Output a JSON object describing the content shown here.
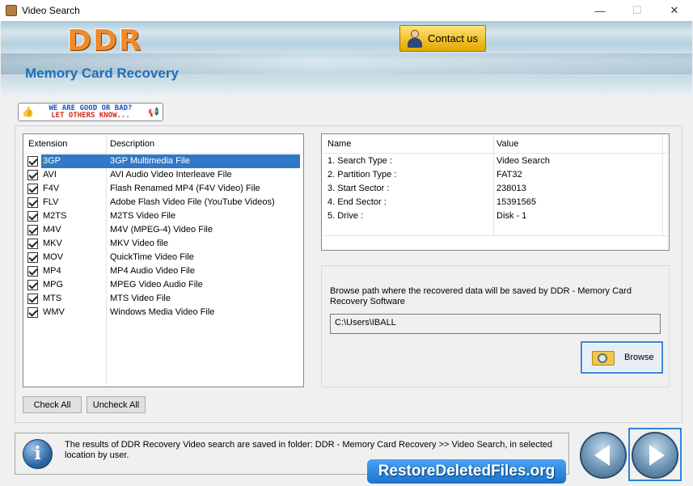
{
  "window": {
    "title": "Video Search",
    "minimize": "—",
    "maximize": "☐",
    "close": "✕"
  },
  "banner": {
    "logo": "DDR",
    "subtitle": "Memory Card Recovery",
    "contact_label": "Contact us"
  },
  "rating": {
    "line1": "WE ARE GOOD OR BAD?",
    "line2": "LET OTHERS KNOW..."
  },
  "extensions": {
    "header_extension": "Extension",
    "header_description": "Description",
    "rows": [
      {
        "ext": "3GP",
        "desc": "3GP Multimedia File",
        "checked": true,
        "selected": true
      },
      {
        "ext": "AVI",
        "desc": "AVI Audio Video Interleave File",
        "checked": true
      },
      {
        "ext": "F4V",
        "desc": "Flash Renamed MP4 (F4V Video) File",
        "checked": true
      },
      {
        "ext": "FLV",
        "desc": "Adobe Flash Video File (YouTube Videos)",
        "checked": true
      },
      {
        "ext": "M2TS",
        "desc": "M2TS Video File",
        "checked": true
      },
      {
        "ext": "M4V",
        "desc": "M4V (MPEG-4) Video File",
        "checked": true
      },
      {
        "ext": "MKV",
        "desc": "MKV Video file",
        "checked": true
      },
      {
        "ext": "MOV",
        "desc": "QuickTime Video File",
        "checked": true
      },
      {
        "ext": "MP4",
        "desc": "MP4 Audio Video File",
        "checked": true
      },
      {
        "ext": "MPG",
        "desc": "MPEG Video Audio File",
        "checked": true
      },
      {
        "ext": "MTS",
        "desc": "MTS Video File",
        "checked": true
      },
      {
        "ext": "WMV",
        "desc": "Windows Media Video File",
        "checked": true
      }
    ]
  },
  "info": {
    "header_name": "Name",
    "header_value": "Value",
    "rows": [
      {
        "name": "1. Search Type :",
        "value": "Video Search"
      },
      {
        "name": "2. Partition Type :",
        "value": "FAT32"
      },
      {
        "name": "3. Start Sector :",
        "value": "238013"
      },
      {
        "name": "4. End Sector :",
        "value": "15391565"
      },
      {
        "name": "5. Drive :",
        "value": "Disk - 1"
      }
    ]
  },
  "browse": {
    "text": "Browse path where the recovered data will be saved by DDR - Memory Card Recovery Software",
    "path": "C:\\Users\\IBALL",
    "button_label": "Browse"
  },
  "buttons": {
    "check_all": "Check All",
    "uncheck_all": "Uncheck All"
  },
  "status": {
    "text": "The results of DDR Recovery Video search are saved in folder: DDR - Memory Card Recovery  >> Video Search, in selected location by user."
  },
  "site_badge": "RestoreDeletedFiles.org",
  "icons": {
    "info": "info-icon",
    "back": "back-arrow-icon",
    "next": "next-arrow-icon",
    "folder": "folder-search-icon",
    "contact": "contact-person-icon"
  },
  "colors": {
    "selection": "#3178c6",
    "logo": "#f08a2c",
    "subtitle": "#1f6fb5",
    "badge": "#2a8ae0"
  }
}
